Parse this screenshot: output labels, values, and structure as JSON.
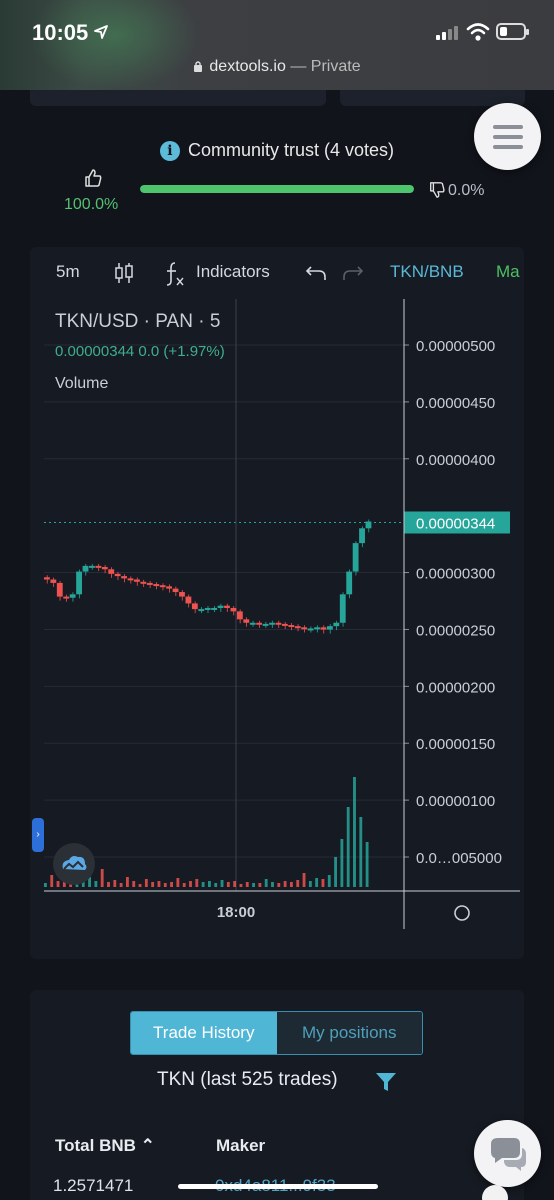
{
  "status_bar": {
    "time": "10:05"
  },
  "browser": {
    "domain": "dextools.io",
    "mode": "— Private"
  },
  "trust": {
    "title": "Community trust (4 votes)",
    "up_pct": "100.0%",
    "down_pct": "0.0%",
    "bar_fill_fraction": 1.0,
    "up_color": "#56c071"
  },
  "toolbar": {
    "interval": "5m",
    "indicators_label": "Indicators",
    "pair_label": "TKN/BNB",
    "ma_label": "Ma"
  },
  "legend": {
    "title": "TKN/USD · PAN · 5",
    "values": "0.00000344  0.0 (+1.97%)",
    "volume_label": "Volume"
  },
  "chart_data": {
    "type": "candlestick",
    "yaxis_ticks": [
      "0.00000500",
      "0.00000450",
      "0.00000400",
      "0.00000344",
      "0.00000300",
      "0.00000250",
      "0.00000200",
      "0.00000150",
      "0.00000100",
      "0.0…005000"
    ],
    "y_tick_values": [
      5.0,
      4.5,
      4.0,
      3.44,
      3.0,
      2.5,
      2.0,
      1.5,
      1.0,
      0.5
    ],
    "y_unit_note": "",
    "ylim": [
      0.2,
      5.4
    ],
    "last_price": "0.00000344",
    "last_price_value": 3.44,
    "xaxis_ticks": [
      "18:00"
    ],
    "up_color": "#26a69a",
    "down_color": "#ef5350",
    "price_series": [
      2.95,
      2.93,
      2.9,
      2.78,
      2.77,
      2.8,
      3.0,
      3.05,
      3.05,
      3.04,
      3.02,
      2.98,
      2.96,
      2.94,
      2.93,
      2.91,
      2.9,
      2.89,
      2.88,
      2.87,
      2.85,
      2.82,
      2.78,
      2.72,
      2.67,
      2.67,
      2.68,
      2.68,
      2.7,
      2.68,
      2.65,
      2.58,
      2.55,
      2.55,
      2.54,
      2.54,
      2.55,
      2.54,
      2.53,
      2.52,
      2.51,
      2.5,
      2.5,
      2.51,
      2.49,
      2.52,
      2.55,
      2.8,
      3.0,
      3.25,
      3.38,
      3.44
    ],
    "volume_series": [
      4,
      12,
      6,
      10,
      14,
      8,
      5,
      10,
      6,
      18,
      5,
      7,
      4,
      10,
      6,
      3,
      8,
      5,
      6,
      4,
      5,
      9,
      4,
      6,
      8,
      5,
      6,
      4,
      7,
      5,
      6,
      3,
      5,
      4,
      4,
      8,
      5,
      4,
      6,
      5,
      7,
      14,
      6,
      9,
      8,
      12,
      30,
      48,
      80,
      110,
      70,
      45
    ]
  },
  "trade": {
    "tab_active": "Trade History",
    "tab_inactive": "My positions",
    "title": "TKN (last 525 trades)",
    "col_total": "Total BNB ⌃",
    "col_maker": "Maker",
    "row_total": "1.2571471",
    "row_maker": "0xd4a811...9f33"
  }
}
